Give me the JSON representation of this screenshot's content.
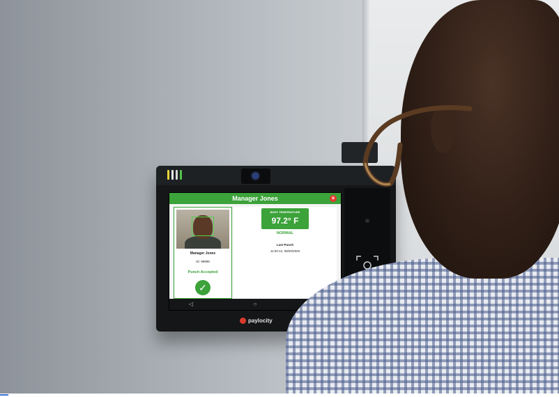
{
  "screen": {
    "header_title": "Manager Jones",
    "close_icon": "close-icon",
    "employee": {
      "name": "Manager Jones",
      "id": "ID: 99999",
      "status": "Punch Accepted"
    },
    "temperature": {
      "label": "BODY TEMPERATURE",
      "value": "97.2° F",
      "status": "NORMAL"
    },
    "last_punch": {
      "label": "Last Punch",
      "value": "11:00:12, 08/20/2020"
    },
    "nav_icons": [
      "back-icon",
      "home-icon",
      "recents-icon"
    ]
  },
  "device": {
    "brand": "paylocity"
  },
  "colors": {
    "accent_green": "#3ca23a",
    "close_red": "#e03b2e",
    "brand_red": "#d93a2b"
  }
}
